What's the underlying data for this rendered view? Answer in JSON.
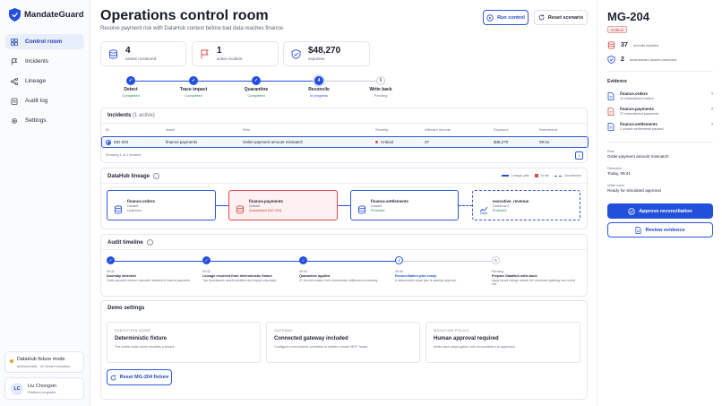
{
  "app": {
    "name": "MandateGuard"
  },
  "nav": [
    {
      "label": "Control room",
      "icon": "grid-icon",
      "active": true
    },
    {
      "label": "Incidents",
      "icon": "flag-icon"
    },
    {
      "label": "Lineage",
      "icon": "lineage-icon"
    },
    {
      "label": "Audit log",
      "icon": "clipboard-icon"
    },
    {
      "label": "Settings",
      "icon": "gear-icon"
    }
  ],
  "fixture": {
    "title": "DataHub fixture mode",
    "sub": "deterministic · no tenant mutation"
  },
  "user": {
    "initials": "LC",
    "name": "Liu Chongxin",
    "role": "Platform engineer"
  },
  "header": {
    "title": "Operations control room",
    "subtitle": "Resolve payment risk with DataHub context before bad data reaches finance.",
    "run_label": "Run control",
    "reset_label": "Reset scenario"
  },
  "stats": [
    {
      "value": "4",
      "label": "assets monitored"
    },
    {
      "value": "1",
      "label": "active incident"
    },
    {
      "value": "$48,270",
      "label": "exposure"
    }
  ],
  "steps": [
    {
      "label": "Detect",
      "status": "Completed",
      "mark": "✓"
    },
    {
      "label": "Trace impact",
      "status": "Completed",
      "mark": "✓"
    },
    {
      "label": "Quarantine",
      "status": "Completed",
      "mark": "✓"
    },
    {
      "label": "Reconcile",
      "status": "In progress",
      "mark": "4"
    },
    {
      "label": "Write back",
      "status": "Pending",
      "mark": "5"
    }
  ],
  "incidents": {
    "title": "Incidents",
    "count": "(1 active)",
    "columns": [
      "ID",
      "Asset",
      "Rule",
      "Severity",
      "Affected records",
      "Exposure",
      "Detected at"
    ],
    "rows": [
      {
        "id": "MG-204",
        "asset": "finance.payments",
        "rule": "Order-payment amount mismatch",
        "severity": "Critical",
        "affected": "37",
        "exposure": "$48,270",
        "detected": "09:41"
      }
    ],
    "footer": "Showing 1 of 1 incident",
    "page": "1"
  },
  "lineage": {
    "title": "DataHub lineage",
    "legend": [
      "Lineage path",
      "At risk",
      "Downstream"
    ],
    "nodes": [
      {
        "name": "finance.orders",
        "meta1": "Dataset",
        "meta2": "Upstream"
      },
      {
        "name": "finance.payments",
        "meta1": "Dataset",
        "meta2": "Quarantined (MG-204)"
      },
      {
        "name": "finance.settlements",
        "meta1": "Dataset",
        "meta2": "Protected"
      },
      {
        "name": "executive_revenue",
        "meta1": "Dashboard",
        "meta2": "Protected"
      }
    ]
  },
  "audit": {
    "title": "Audit timeline",
    "events": [
      {
        "time": "09:41",
        "title": "Anomaly detected",
        "desc": "Order-payment amount mismatch detected in finance.payments.",
        "mark": "✓"
      },
      {
        "time": "09:42",
        "title": "Lineage resolved from deterministic fixture",
        "desc": "Two downstream assets identified and impact calculated.",
        "mark": "✓"
      },
      {
        "time": "09:43",
        "title": "Quarantine applied",
        "desc": "37 records isolated from downstream settlement processing.",
        "mark": "✓"
      },
      {
        "time": "09:44",
        "title": "Reconciliation plan ready",
        "desc": "A deterministic repair plan is awaiting approval.",
        "mark": "4"
      },
      {
        "time": "Pending",
        "title": "Prepare DataHub write-back",
        "desc": "Apply tenant lineage results; the connected gateway can control incr.",
        "mark": "5"
      }
    ]
  },
  "demo": {
    "title": "Demo settings",
    "cards": [
      {
        "caption": "EXECUTION MODE",
        "title": "Deterministic fixture",
        "desc": "The public build never mutates a tenant."
      },
      {
        "caption": "GATEWAY",
        "title": "Connected gateway included",
        "desc": "Configure environment variables to enable remote MCP reads."
      },
      {
        "caption": "MUTATION POLICY",
        "title": "Human approval required",
        "desc": "Write-back stays gated until reconciliation is approved."
      }
    ],
    "reset_label": "Reset MG-204 fixture"
  },
  "detail": {
    "id": "MG-204",
    "severity": "Critical",
    "records": "37",
    "records_label": "records isolated",
    "protected": "2",
    "protected_label": "downstream assets protected",
    "evidence_title": "Evidence",
    "evidence": [
      {
        "name": "finance.orders",
        "meta": "12 mismatched orders"
      },
      {
        "name": "finance.payments",
        "meta": "37 mismatched payments"
      },
      {
        "name": "finance.settlements",
        "meta": "2 unsafe settlements paused"
      }
    ],
    "rule_label": "Rule",
    "rule": "Order-payment amount mismatch",
    "detected_label": "Detected",
    "detected": "Today, 09:41",
    "writeback_label": "Write back",
    "writeback": "Ready for simulated approval",
    "approve_label": "Approve reconciliation",
    "review_label": "Review evidence"
  },
  "colors": {
    "accent": "#2350db",
    "critical": "#d94a4a",
    "success": "#1f8a4c"
  }
}
